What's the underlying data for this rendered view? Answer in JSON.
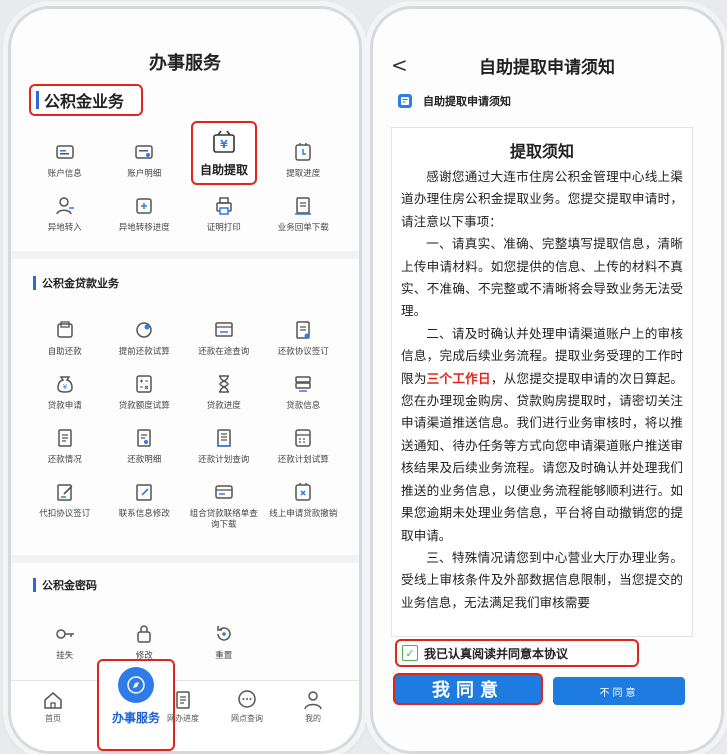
{
  "left": {
    "title": "办事服务",
    "section1": {
      "title": "公积金业务",
      "items": [
        {
          "label": "账户信息",
          "icon": "account-card-icon"
        },
        {
          "label": "账户明细",
          "icon": "account-detail-icon"
        },
        {
          "label": "自助提取",
          "icon": "yuan-wallet-icon"
        },
        {
          "label": "提取进度",
          "icon": "progress-icon"
        },
        {
          "label": "异地转入",
          "icon": "transfer-in-icon"
        },
        {
          "label": "异地转移进度",
          "icon": "transfer-progress-icon"
        },
        {
          "label": "证明打印",
          "icon": "print-icon"
        },
        {
          "label": "业务回单下载",
          "icon": "download-icon"
        }
      ]
    },
    "section2": {
      "title": "公积金贷款业务",
      "items": [
        {
          "label": "自助还款"
        },
        {
          "label": "提前还款试算"
        },
        {
          "label": "还款在途查询"
        },
        {
          "label": "还款协议签订"
        },
        {
          "label": "贷款申请"
        },
        {
          "label": "贷款额度试算"
        },
        {
          "label": "贷款进度"
        },
        {
          "label": "贷款信息"
        },
        {
          "label": "还款情况"
        },
        {
          "label": "还款明细"
        },
        {
          "label": "还款计划查询"
        },
        {
          "label": "还款计划试算"
        },
        {
          "label": "代扣协议签订"
        },
        {
          "label": "联系信息修改"
        },
        {
          "label": "组合贷款联络单查询下载"
        },
        {
          "label": "线上申请贷款撤销"
        }
      ]
    },
    "section3": {
      "title": "公积金密码",
      "items": [
        {
          "label": "挂失"
        },
        {
          "label": "修改"
        },
        {
          "label": "重置"
        }
      ]
    },
    "tabbar": [
      {
        "label": "首页"
      },
      {
        "label": "办事服务"
      },
      {
        "label": "网办进度"
      },
      {
        "label": "网点查询"
      },
      {
        "label": "我的"
      }
    ]
  },
  "right": {
    "back": "<",
    "title": "自助提取申请须知",
    "subtitle": "自助提取申请须知",
    "doc": {
      "heading": "提取须知",
      "p1": "感谢您通过大连市住房公积金管理中心线上渠道办理住房公积金提取业务。您提交提取申请时，请注意以下事项：",
      "p2": "一、请真实、准确、完整填写提取信息，清晰上传申请材料。如您提供的信息、上传的材料不真实、不准确、不完整或不清晰将会导致业务无法受理。",
      "p3_a": "二、请及时确认并处理申请渠道账户上的审核信息，完成后续业务流程。提取业务受理的工作时限为",
      "p3_red": "三个工作日",
      "p3_b": "，从您提交提取申请的次日算起。您在办理现金购房、贷款购房提取时，请密切关注申请渠道推送信息。我们进行业务审核时，将以推送通知、待办任务等方式向您申请渠道账户推送审核结果及后续业务流程。请您及时确认并处理我们推送的业务信息，以便业务流程能够顺利进行。如果您逾期未处理业务信息，平台将自动撤销您的提取申请。",
      "p4": "三、特殊情况请您到中心营业大厅办理业务。受线上审核条件及外部数据信息限制，当您提交的业务信息，无法满足我们审核需要"
    },
    "agree_text": "我已认真阅读并同意本协议",
    "agree_btn": "我同意",
    "disagree_btn": "不同意"
  },
  "colors": {
    "accent": "#1e7be0",
    "highlight": "#e1251b",
    "red_text": "#e1251b"
  }
}
